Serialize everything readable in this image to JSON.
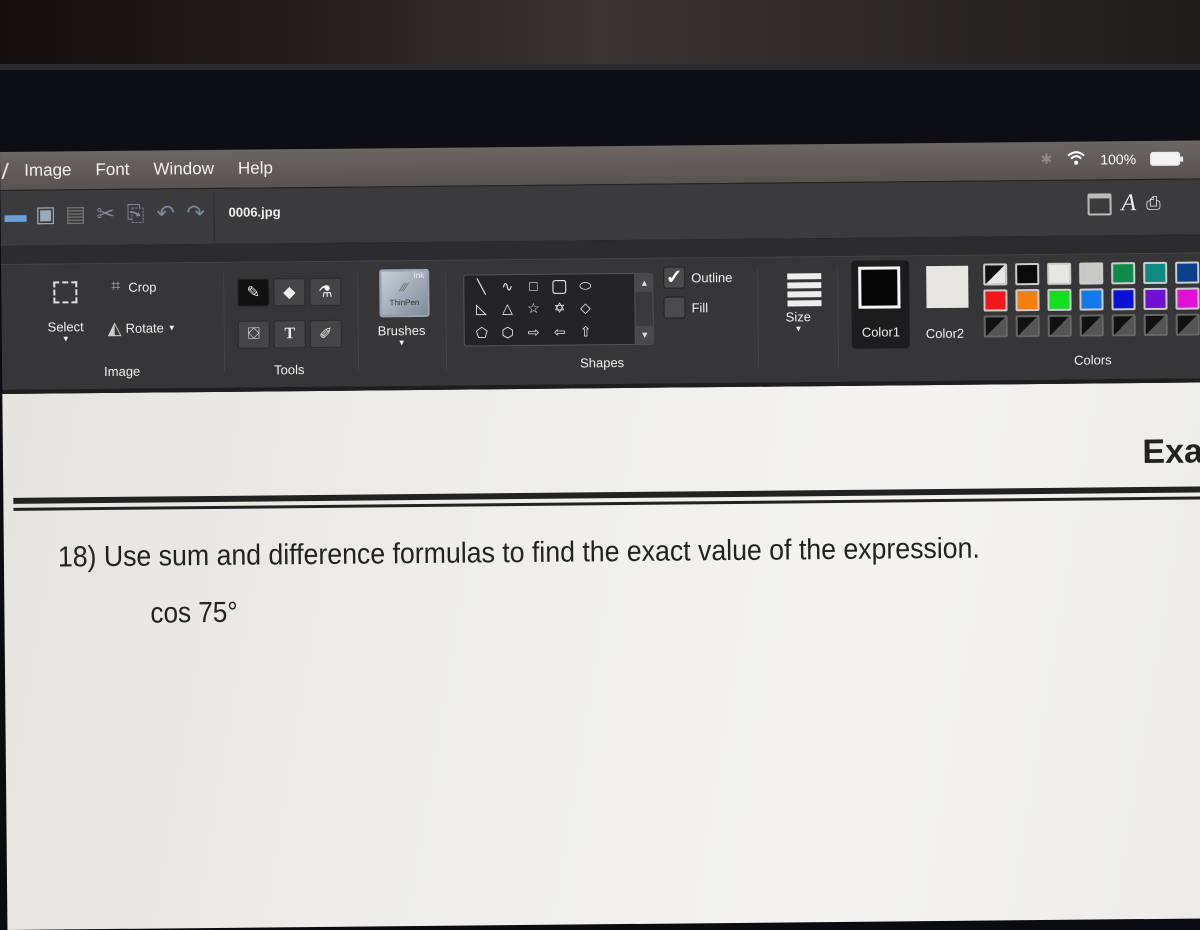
{
  "menubar": {
    "items": [
      "Image",
      "Font",
      "Window",
      "Help"
    ],
    "status": {
      "bluetooth_icon": "bluetooth-icon",
      "wifi_icon": "wifi-icon",
      "battery_percent": "100%"
    }
  },
  "toolbar": {
    "quick_access": [
      "open-icon",
      "save-icon",
      "copy-icon",
      "cut-icon",
      "paste-icon",
      "undo-icon",
      "redo-icon"
    ],
    "filename": "0006.jpg",
    "right_icons": [
      "window-icon",
      "font-icon",
      "print-icon"
    ]
  },
  "ribbon": {
    "image_group": {
      "label": "Image",
      "select_label": "Select",
      "crop_label": "Crop",
      "rotate_label": "Rotate"
    },
    "tools_group": {
      "label": "Tools",
      "tools": [
        "pencil",
        "eraser",
        "spray",
        "fill-bucket",
        "text",
        "color-picker"
      ],
      "active_tool": "pencil"
    },
    "brushes": {
      "label": "Brushes",
      "preview_top": "Ink",
      "preview_bottom": "ThinPen"
    },
    "shapes": {
      "label": "Shapes",
      "items": [
        "line",
        "curve",
        "rectangle",
        "rounded-rectangle",
        "ellipse",
        "right-triangle",
        "triangle",
        "star-5",
        "star-6",
        "diamond",
        "pentagon",
        "hexagon",
        "arrow-right",
        "arrow-left",
        "arrow-up"
      ],
      "outline_label": "Outline",
      "outline_checked": true,
      "fill_label": "Fill",
      "fill_checked": false
    },
    "size": {
      "label": "Size"
    },
    "colors": {
      "label": "Colors",
      "color1_label": "Color1",
      "color1": "#050505",
      "color2_label": "Color2",
      "color2": "#e8e6e2",
      "palette_row1": [
        "first",
        "#0a0a0a",
        "#e6e6e2",
        "#c8c8c4",
        "#0f8a4a",
        "#0e8a80",
        "#0b3f8a",
        "#10107a"
      ],
      "palette_row2": [
        "#f01818",
        "#f08010",
        "#10e020",
        "#1478e8",
        "#0a10d8",
        "#7010d0",
        "#e010d8",
        "#e06050"
      ]
    }
  },
  "document": {
    "header_partial": "Exa",
    "question": "18) Use sum and difference formulas to find the exact value of the expression.",
    "expression": "cos 75°"
  }
}
